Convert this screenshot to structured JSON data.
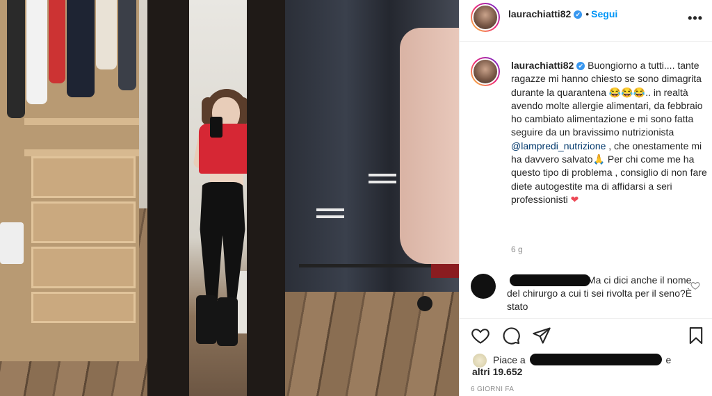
{
  "post": {
    "username": "laurachiatti82",
    "verified_mark": "✔",
    "separator": "•",
    "follow_label": "Segui",
    "more_label": "•••"
  },
  "caption": {
    "username": "laurachiatti82",
    "text_part1": "Buongiorno a tutti.... tante ragazze mi hanno chiesto se sono dimagrita durante la quarantena ",
    "emojis_laugh": "😂😂😂",
    "text_part2": ".. in realtà avendo molte allergie alimentari, da febbraio ho cambiato alimentazione e mi sono fatta seguire da un bravissimo nutrizionista ",
    "mention": "@lampredi_nutrizione",
    "text_part3": " , che onestamente mi ha davvero salvato",
    "emoji_pray": "🙏",
    "text_part4": " Per chi come me ha questo tipo di problema , consiglio di non fare diete autogestite ma di affidarsi a seri professionisti ",
    "emoji_heart": "❤",
    "time_ago": "6 g"
  },
  "comment": {
    "text": "Ma ci dici anche il nome del chirurgo a cui ti sei rivolta per il seno?È stato"
  },
  "likes": {
    "prefix": "Piace a",
    "suffix": "e",
    "others": "altri 19.652"
  },
  "date": "6 GIORNI FA",
  "icons": {
    "more": "more-dots-icon",
    "like": "heart-icon",
    "comment": "comment-bubble-icon",
    "share": "paper-plane-icon",
    "save": "bookmark-icon",
    "comment_like": "heart-small-icon"
  },
  "colors": {
    "link_blue": "#0095f6",
    "mention": "#00376b",
    "muted": "#8e8e8e",
    "verified": "#3897f0"
  }
}
